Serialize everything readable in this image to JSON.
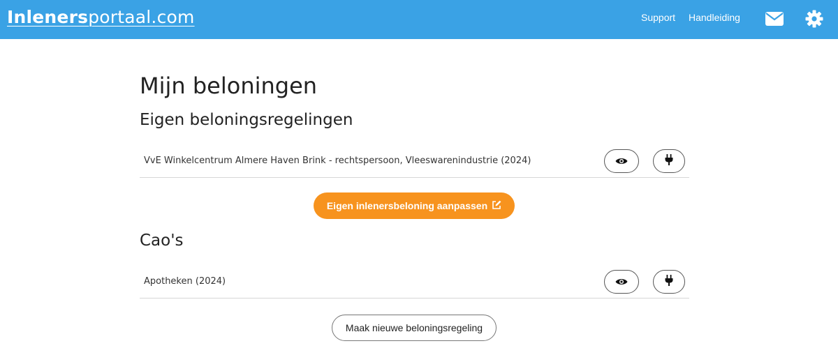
{
  "header": {
    "logo_bold": "Inleners",
    "logo_rest": "portaal.com",
    "nav_support": "Support",
    "nav_handleiding": "Handleiding",
    "icons": [
      "mail-icon",
      "gear-icon"
    ]
  },
  "main": {
    "title": "Mijn beloningen",
    "own_section": {
      "title": "Eigen beloningsregelingen",
      "items": [
        {
          "label": "VvE Winkelcentrum Almere Haven Brink - rechtspersoon, Vleeswarenindustrie (2024)"
        }
      ],
      "edit_button": "Eigen inlenersbeloning aanpassen"
    },
    "cao_section": {
      "title": "Cao's",
      "items": [
        {
          "label": "Apotheken (2024)"
        }
      ]
    },
    "new_button": "Maak nieuwe beloningsregeling"
  },
  "colors": {
    "header_bg": "#3aa2e5",
    "accent_orange": "#f7931e"
  }
}
